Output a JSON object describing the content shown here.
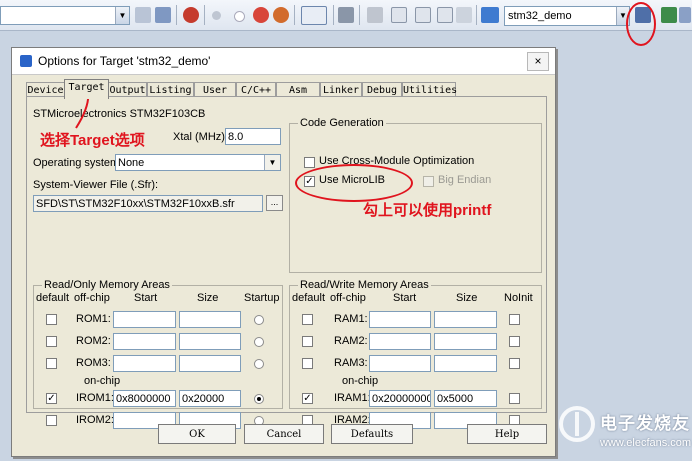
{
  "toolbar": {
    "target_select": "stm32_demo",
    "icons": [
      "find-icon",
      "debug-start-icon",
      "circle-icon",
      "circle-icon",
      "stop-icon",
      "options-icon",
      "view-icon",
      "tools-icon",
      "books-icon",
      "window-icon",
      "window-icon",
      "load-icon",
      "target-options-icon",
      "components-icon"
    ]
  },
  "dialog": {
    "title": "Options for Target 'stm32_demo'",
    "close": "×",
    "tabs": [
      "Device",
      "Target",
      "Output",
      "Listing",
      "User",
      "C/C++",
      "Asm",
      "Linker",
      "Debug",
      "Utilities"
    ],
    "active_tab": "Target",
    "device_name": "STMicroelectronics STM32F103CB",
    "xtal_label": "Xtal (MHz):",
    "xtal_value": "8.0",
    "os_label": "Operating system:",
    "os_value": "None",
    "sysviewer_label": "System-Viewer File (.Sfr):",
    "sysviewer_value": "SFD\\ST\\STM32F10xx\\STM32F10xxB.sfr",
    "browse": "...",
    "code_gen": {
      "title": "Code Generation",
      "cross_module": "Use Cross-Module Optimization",
      "microlib": "Use MicroLIB",
      "big_endian": "Big Endian"
    },
    "ro_mem": {
      "title": "Read/Only Memory Areas",
      "headers": {
        "default": "default",
        "offchip": "off-chip",
        "start": "Start",
        "size": "Size",
        "startup": "Startup"
      },
      "onchip": "on-chip",
      "rows": [
        {
          "name": "ROM1:",
          "start": "",
          "size": "",
          "checked": false,
          "startup": false
        },
        {
          "name": "ROM2:",
          "start": "",
          "size": "",
          "checked": false,
          "startup": false
        },
        {
          "name": "ROM3:",
          "start": "",
          "size": "",
          "checked": false,
          "startup": false
        },
        {
          "name": "IROM1:",
          "start": "0x8000000",
          "size": "0x20000",
          "checked": true,
          "startup": true
        },
        {
          "name": "IROM2:",
          "start": "",
          "size": "",
          "checked": false,
          "startup": false
        }
      ]
    },
    "rw_mem": {
      "title": "Read/Write Memory Areas",
      "headers": {
        "default": "default",
        "offchip": "off-chip",
        "start": "Start",
        "size": "Size",
        "noinit": "NoInit"
      },
      "onchip": "on-chip",
      "rows": [
        {
          "name": "RAM1:",
          "start": "",
          "size": "",
          "checked": false
        },
        {
          "name": "RAM2:",
          "start": "",
          "size": "",
          "checked": false
        },
        {
          "name": "RAM3:",
          "start": "",
          "size": "",
          "checked": false
        },
        {
          "name": "IRAM1:",
          "start": "0x20000000",
          "size": "0x5000",
          "checked": true
        },
        {
          "name": "IRAM2:",
          "start": "",
          "size": "",
          "checked": false
        }
      ]
    },
    "buttons": {
      "ok": "OK",
      "cancel": "Cancel",
      "defaults": "Defaults",
      "help": "Help"
    }
  },
  "annotations": {
    "select_target": "选择Target选项",
    "check_printf": "勾上可以使用printf"
  },
  "watermark": {
    "brand": "电子发烧友",
    "url": "www.elecfans.com"
  },
  "colors": {
    "annotation": "#e0141e",
    "accent": "#2a64c8"
  }
}
